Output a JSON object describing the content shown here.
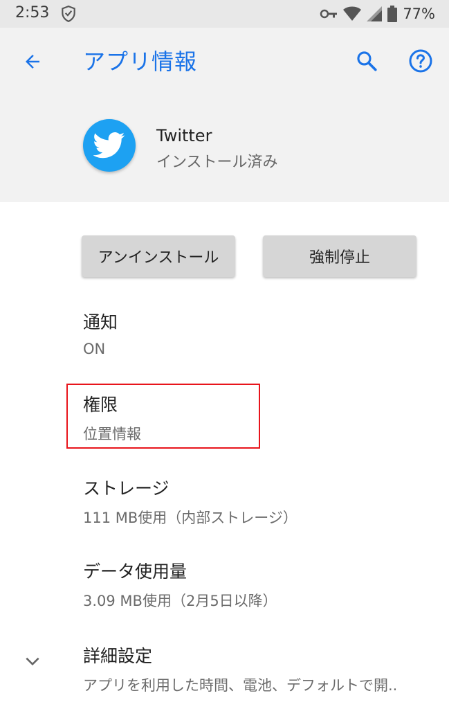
{
  "status_bar": {
    "time": "2:53",
    "battery": "77%",
    "icons": [
      "shield-icon",
      "vpn-key-icon",
      "wifi-icon",
      "signal-icon",
      "battery-icon"
    ]
  },
  "app_bar": {
    "title": "アプリ情報",
    "icons": [
      "back-arrow-icon",
      "search-icon",
      "help-icon"
    ],
    "accent_color": "#1a73e8"
  },
  "app": {
    "name": "Twitter",
    "status": "インストール済み",
    "icon": "twitter-bird-icon",
    "icon_color": "#1da1f2"
  },
  "buttons": {
    "uninstall": "アンインストール",
    "force_stop": "強制停止"
  },
  "settings": {
    "notifications": {
      "title": "通知",
      "value": "ON"
    },
    "permissions": {
      "title": "権限",
      "value": "位置情報"
    },
    "storage": {
      "title": "ストレージ",
      "value": "111 MB使用（内部ストレージ）"
    },
    "data_usage": {
      "title": "データ使用量",
      "value": "3.09 MB使用（2月5日以降）"
    },
    "advanced": {
      "title": "詳細設定",
      "value": "アプリを利用した時間、電池、デフォルトで開.."
    }
  },
  "highlight_color": "#e8141b"
}
